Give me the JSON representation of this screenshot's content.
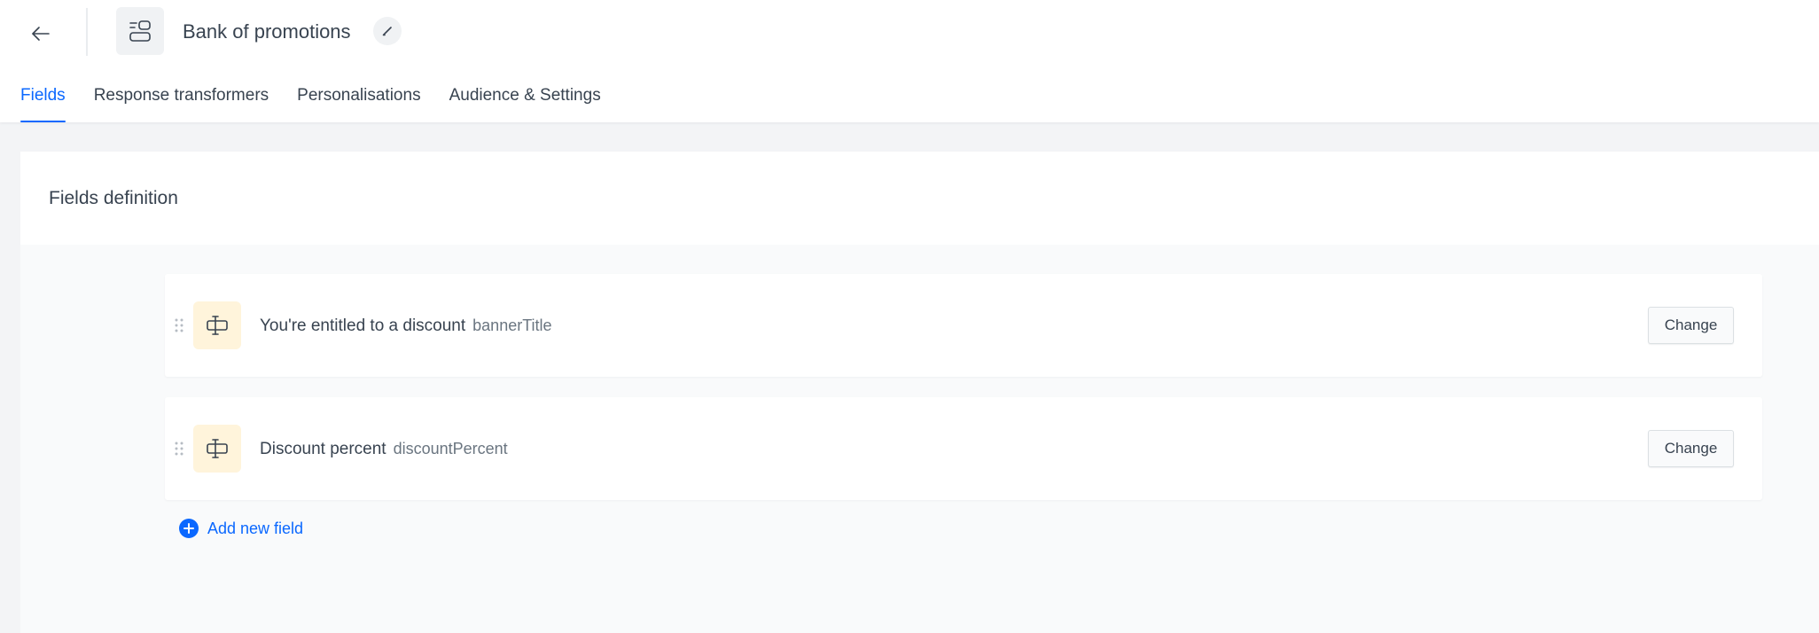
{
  "header": {
    "title": "Bank of promotions",
    "back_icon": "arrow-left-icon",
    "object_icon": "layout-icon",
    "edit_icon": "pencil-icon"
  },
  "tabs": [
    {
      "label": "Fields",
      "active": true
    },
    {
      "label": "Response transformers",
      "active": false
    },
    {
      "label": "Personalisations",
      "active": false
    },
    {
      "label": "Audience & Settings",
      "active": false
    }
  ],
  "card": {
    "title": "Fields definition"
  },
  "fields": [
    {
      "name": "You're entitled to a discount",
      "key": "bannerTitle",
      "icon": "text-field-icon",
      "change_label": "Change"
    },
    {
      "name": "Discount percent",
      "key": "discountPercent",
      "icon": "text-field-icon",
      "change_label": "Change"
    }
  ],
  "add_field": {
    "label": "Add new field",
    "icon": "plus-circle-icon"
  },
  "colors": {
    "accent": "#0b68ff",
    "text": "#384350",
    "muted": "#6a7580",
    "field_icon_bg": "#fff4db"
  }
}
